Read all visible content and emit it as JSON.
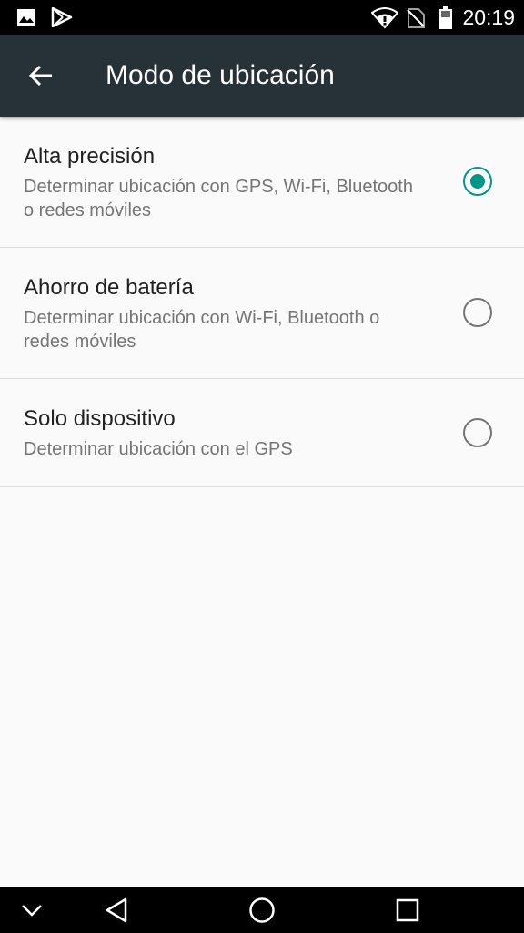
{
  "status_bar": {
    "time": "20:19",
    "icons": [
      "image-icon",
      "play-store-icon",
      "wifi-icon",
      "no-sim-icon",
      "battery-icon"
    ]
  },
  "toolbar": {
    "title": "Modo de ubicación",
    "back_icon": "arrow-back-icon"
  },
  "options": [
    {
      "title": "Alta precisión",
      "summary": "Determinar ubicación con GPS, Wi-Fi, Bluetooth o redes móviles",
      "selected": true
    },
    {
      "title": "Ahorro de batería",
      "summary": "Determinar ubicación con Wi-Fi, Bluetooth o redes móviles",
      "selected": false
    },
    {
      "title": "Solo dispositivo",
      "summary": "Determinar ubicación con el GPS",
      "selected": false
    }
  ],
  "nav_bar": {
    "icons": [
      "chevron-down-icon",
      "back-triangle-icon",
      "home-circle-icon",
      "recents-square-icon"
    ]
  },
  "colors": {
    "toolbar": "#263238",
    "accent": "#009688",
    "background": "#fafafa"
  }
}
